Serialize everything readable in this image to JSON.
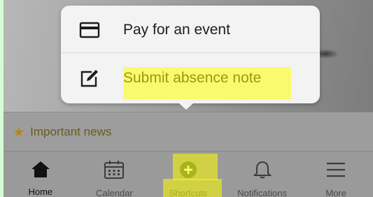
{
  "popup": {
    "items": [
      {
        "label": "Pay for an event",
        "icon": "credit-card-icon"
      },
      {
        "label": "Submit absence note",
        "icon": "edit-note-icon"
      }
    ]
  },
  "news": {
    "label": "Important news",
    "icon": "star-icon"
  },
  "tabs": [
    {
      "label": "Home",
      "icon": "home-icon"
    },
    {
      "label": "Calendar",
      "icon": "calendar-icon"
    },
    {
      "label": "Shortcuts",
      "icon": "add-circle-icon"
    },
    {
      "label": "Notifications",
      "icon": "bell-icon"
    },
    {
      "label": "More",
      "icon": "menu-icon"
    }
  ],
  "colors": {
    "highlight": "#ffff00",
    "accent_star": "#b8860b",
    "background": "#d6fcd6"
  }
}
